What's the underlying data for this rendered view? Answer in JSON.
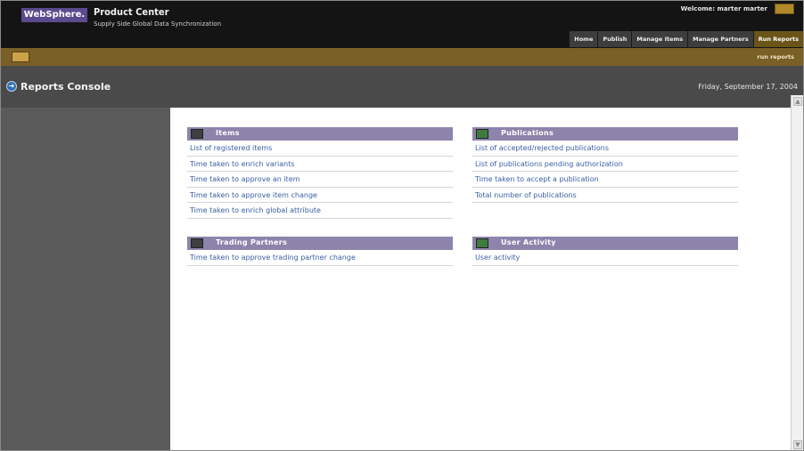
{
  "header": {
    "logo": "WebSphere.",
    "product": "Product Center",
    "subtitle": "Supply Side Global Data Synchronization",
    "welcome": "Welcome: marter marter",
    "nav": [
      {
        "label": "Home",
        "active": false
      },
      {
        "label": "Publish",
        "active": false
      },
      {
        "label": "Manage Items",
        "active": false
      },
      {
        "label": "Manage Partners",
        "active": false
      },
      {
        "label": "Run Reports",
        "active": true
      }
    ]
  },
  "strip": {
    "link": "run reports"
  },
  "console": {
    "title": "Reports Console",
    "date": "Friday, September 17, 2004"
  },
  "sections": {
    "items": {
      "title": "Items",
      "links": [
        "List of registered items",
        "Time taken to enrich variants",
        "Time taken to approve an item",
        "Time taken to approve item change",
        "Time taken to enrich global attribute"
      ]
    },
    "publications": {
      "title": "Publications",
      "links": [
        "List of accepted/rejected publications",
        "List of publications pending authorization",
        "Time taken to accept a publication",
        "Total number of publications"
      ]
    },
    "trading_partners": {
      "title": "Trading Partners",
      "links": [
        "Time taken to approve trading partner change"
      ]
    },
    "user_activity": {
      "title": "User Activity",
      "links": [
        "User activity"
      ]
    }
  },
  "icons": {
    "console": "arrow-circle-icon",
    "items": "items-icon",
    "publications": "publications-icon",
    "trading_partners": "trading-partners-icon",
    "user_activity": "user-activity-icon",
    "welcome": "user-icon",
    "strip": "toolbar-icon"
  },
  "colors": {
    "header_bg": "#141414",
    "strip_bg": "#7a6026",
    "console_bg": "#4a4a4a",
    "left_panel": "#5a5a5a",
    "section_head": "#8d84ab",
    "link": "#3a5fa5",
    "logo_bg": "#5b4a8e"
  }
}
